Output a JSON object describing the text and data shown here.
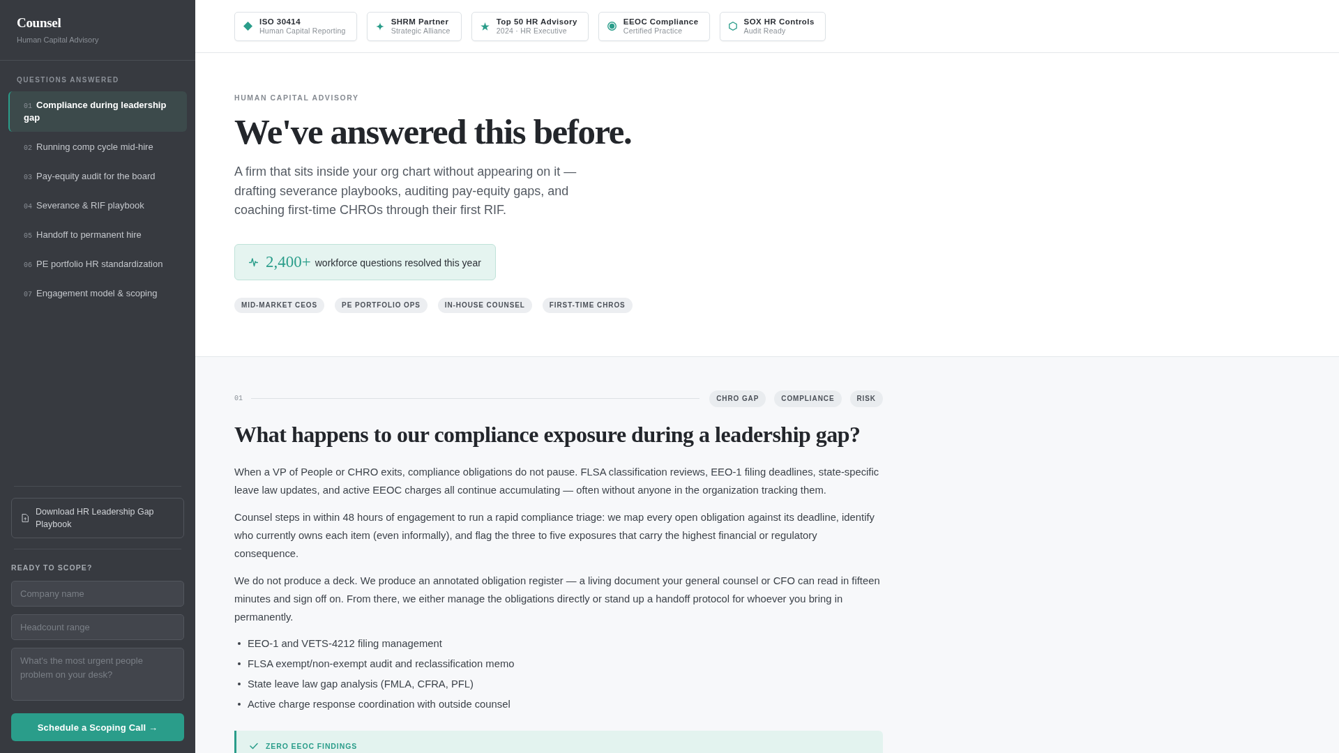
{
  "sidebar": {
    "brand": "Counsel",
    "tagline": "Human Capital Advisory",
    "nav_heading": "QUESTIONS ANSWERED",
    "items": [
      {
        "number": "01",
        "label": "Compliance during leadership gap",
        "selected": true
      },
      {
        "number": "02",
        "label": "Running comp cycle mid-hire",
        "selected": false
      },
      {
        "number": "03",
        "label": "Pay-equity audit for the board",
        "selected": false
      },
      {
        "number": "04",
        "label": "Severance & RIF playbook",
        "selected": false
      },
      {
        "number": "05",
        "label": "Handoff to permanent hire",
        "selected": false
      },
      {
        "number": "06",
        "label": "PE portfolio HR standardization",
        "selected": false
      },
      {
        "number": "07",
        "label": "Engagement model & scoping",
        "selected": false
      }
    ],
    "download": {
      "label": "Download HR Leadership Gap Playbook"
    },
    "form": {
      "heading": "READY TO SCOPE?",
      "fields": [
        {
          "kind": "input",
          "placeholder": "Company name"
        },
        {
          "kind": "input",
          "placeholder": "Headcount range"
        },
        {
          "kind": "textarea",
          "placeholder": "What's the most urgent people problem on your desk?"
        }
      ],
      "submit": "Schedule a Scoping Call →"
    }
  },
  "badges": [
    {
      "title": "ISO 30414",
      "subtitle": "Human Capital Reporting"
    },
    {
      "title": "SHRM Partner",
      "subtitle": "Strategic Alliance"
    },
    {
      "title": "Top 50 HR Advisory",
      "subtitle": "2024 · HR Executive"
    },
    {
      "title": "EEOC Compliance",
      "subtitle": "Certified Practice"
    },
    {
      "title": "SOX HR Controls",
      "subtitle": "Audit Ready"
    }
  ],
  "hero": {
    "eyebrow": "HUMAN CAPITAL ADVISORY",
    "title": "We've answered this before.",
    "lead": "A firm that sits inside your org chart without appearing on it — drafting severance playbooks, auditing pay-equity gaps, and coaching first-time CHROs through their first RIF.",
    "stat": {
      "value": "2,400+",
      "label": "workforce questions resolved this year"
    },
    "audiences": [
      "MID-MARKET CEOS",
      "PE PORTFOLIO OPS",
      "IN-HOUSE COUNSEL",
      "FIRST-TIME CHROS"
    ]
  },
  "question": {
    "number": "01",
    "tags": [
      "CHRO GAP",
      "COMPLIANCE",
      "RISK"
    ],
    "title": "What happens to our compliance exposure during a leadership gap?",
    "paragraphs": [
      "When a VP of People or CHRO exits, compliance obligations do not pause. FLSA classification reviews, EEO-1 filing deadlines, state-specific leave law updates, and active EEOC charges all continue accumulating — often without anyone in the organization tracking them.",
      "Counsel steps in within 48 hours of engagement to run a rapid compliance triage: we map every open obligation against its deadline, identify who currently owns each item (even informally), and flag the three to five exposures that carry the highest financial or regulatory consequence.",
      "We do not produce a deck. We produce an annotated obligation register — a living document your general counsel or CFO can read in fifteen minutes and sign off on. From there, we either manage the obligations directly or stand up a handoff protocol for whoever you bring in permanently."
    ],
    "bullets": [
      "EEO-1 and VETS-4212 filing management",
      "FLSA exempt/non-exempt audit and reclassification memo",
      "State leave law gap analysis (FMLA, CFRA, PFL)",
      "Active charge response coordination with outside counsel"
    ],
    "callout": {
      "label": "ZERO EEOC FINDINGS"
    }
  }
}
